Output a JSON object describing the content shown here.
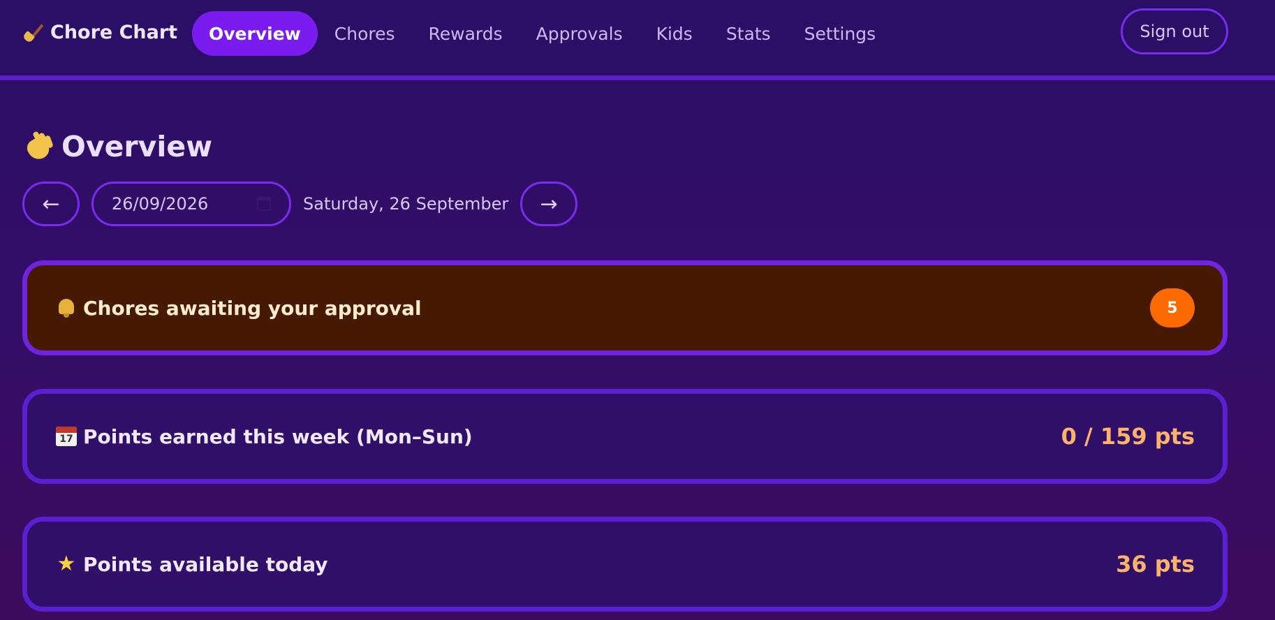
{
  "app": {
    "brand": "Chore Chart",
    "brand_icon": "broom-icon"
  },
  "nav": {
    "items": [
      {
        "label": "Overview",
        "active": true
      },
      {
        "label": "Chores",
        "active": false
      },
      {
        "label": "Rewards",
        "active": false
      },
      {
        "label": "Approvals",
        "active": false
      },
      {
        "label": "Kids",
        "active": false
      },
      {
        "label": "Stats",
        "active": false
      },
      {
        "label": "Settings",
        "active": false
      }
    ],
    "sign_out_label": "Sign out"
  },
  "page": {
    "title": "Overview",
    "title_icon": "waving-hand-icon"
  },
  "date_nav": {
    "prev_symbol": "←",
    "next_symbol": "→",
    "date_value": "26/09/2026",
    "date_long": "Saturday, 26 September"
  },
  "cards": {
    "approval": {
      "label": "Chores awaiting your approval",
      "icon": "bell-icon",
      "count": "5"
    },
    "week": {
      "label": "Points earned this week (Mon–Sun)",
      "icon": "calendar-icon",
      "calendar_day": "17",
      "value": "0 / 159 pts"
    },
    "today": {
      "label": "Points available today",
      "icon": "star-icon",
      "value": "36 pts"
    }
  },
  "colors": {
    "accent": "#7a1cf0",
    "border": "#5a1fd0",
    "badge": "#ff6a00",
    "points": "#ffb26b",
    "approval_bg": "#461a02"
  }
}
